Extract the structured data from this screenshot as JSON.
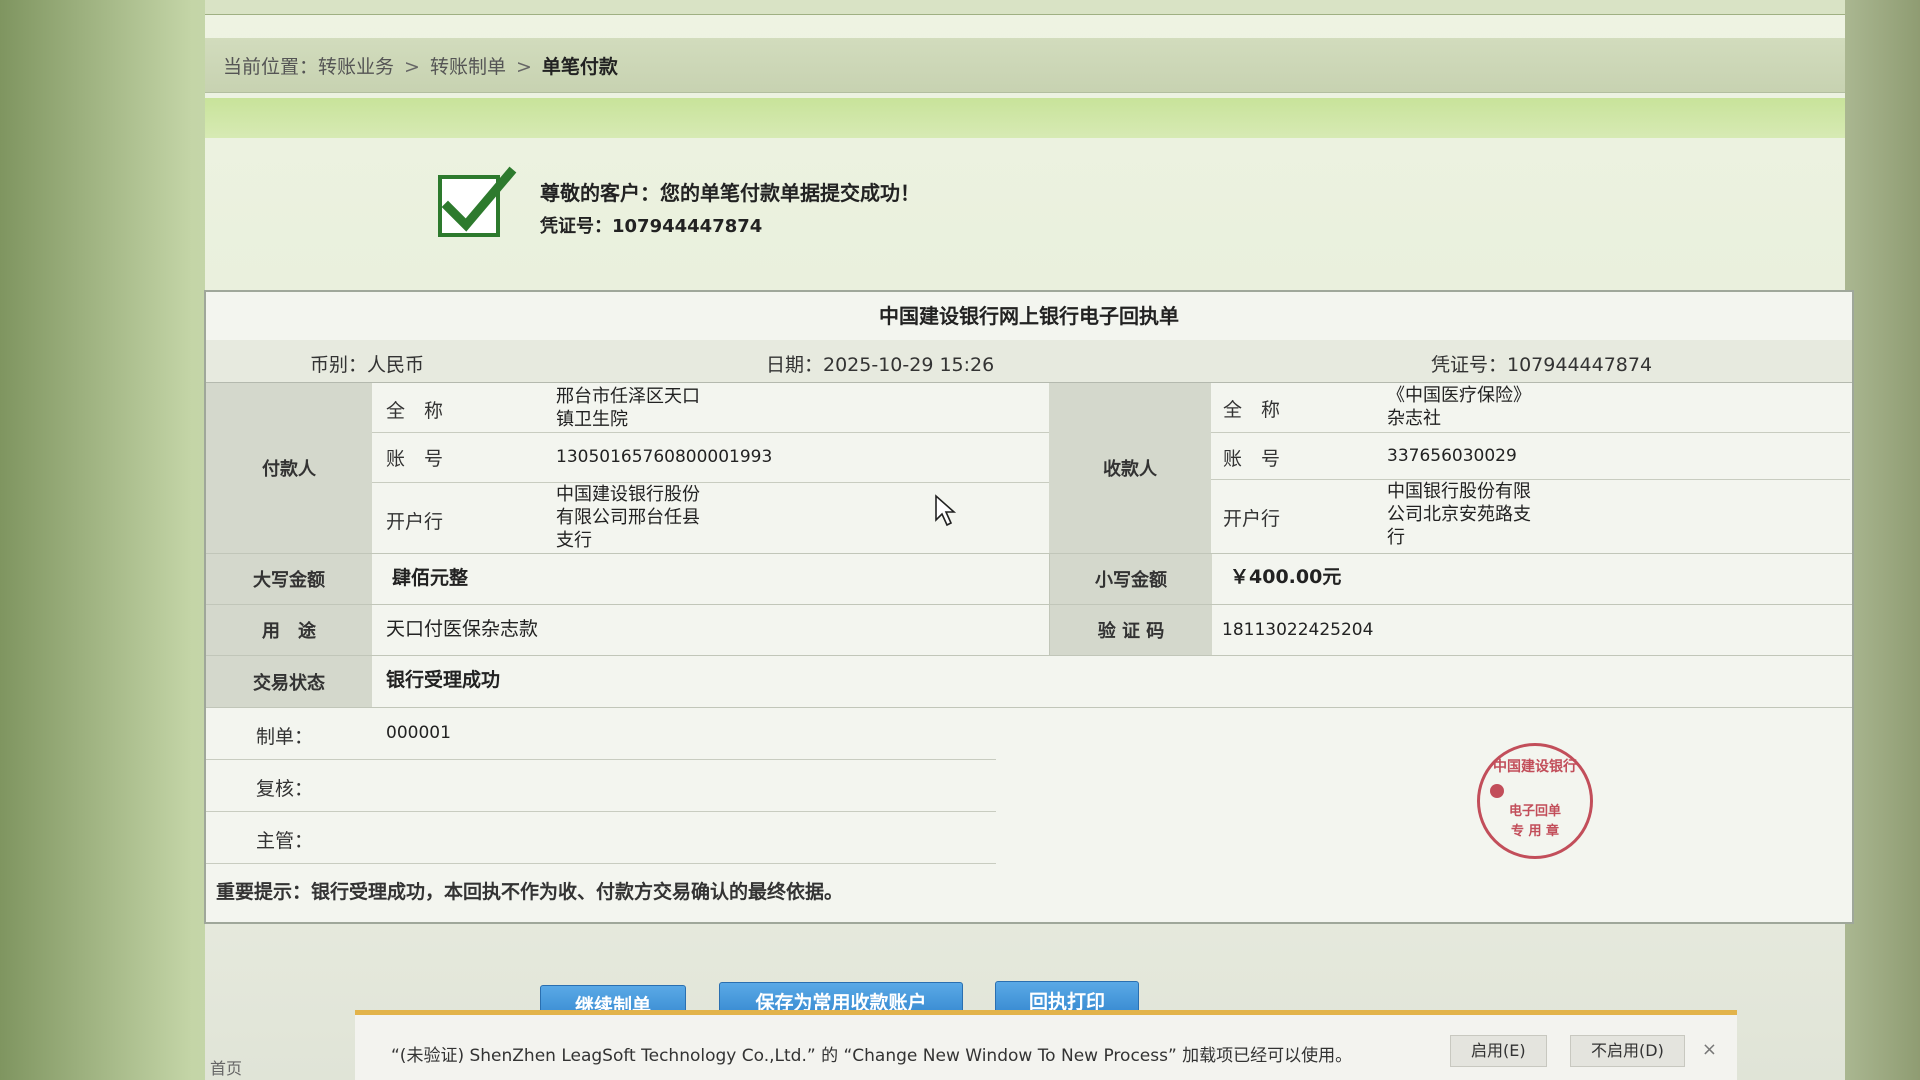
{
  "breadcrumb": {
    "prefix": "当前位置：",
    "items": [
      "转账业务",
      "转账制单",
      "单笔付款"
    ],
    "sep": ">"
  },
  "success": {
    "message": "尊敬的客户：您的单笔付款单据提交成功！",
    "voucher_line": "凭证号：107944447874"
  },
  "receipt": {
    "title": "中国建设银行网上银行电子回执单",
    "currency": "币别：人民币",
    "date": "日期：2025-10-29 15:26",
    "voucher": "凭证号：107944447874",
    "payer_label": "付款人",
    "payee_label": "收款人",
    "payer": {
      "name_label": "全　称",
      "name": [
        "邢台市任泽区天口",
        "镇卫生院"
      ],
      "account_label": "账　号",
      "account": "13050165760800001993",
      "bank_label": "开户行",
      "bank": [
        "中国建设银行股份",
        "有限公司邢台任县",
        "支行"
      ]
    },
    "payee": {
      "name_label": "全　称",
      "name": [
        "《中国医疗保险》",
        "杂志社"
      ],
      "account_label": "账　号",
      "account": "337656030029",
      "bank_label": "开户行",
      "bank": [
        "中国银行股份有限",
        "公司北京安苑路支",
        "行"
      ]
    },
    "amount_words_label": "大写金额",
    "amount_words": "肆佰元整",
    "amount_label": "小写金额",
    "amount": "￥400.00元",
    "purpose_label": "用　途",
    "purpose": "天口付医保杂志款",
    "verify_label": "验 证 码",
    "verify_code": "18113022425204",
    "status_label": "交易状态",
    "status": "银行受理成功",
    "maker_label": "制单：",
    "maker": "000001",
    "checker_label": "复核：",
    "checker": "",
    "supervisor_label": "主管：",
    "supervisor": "",
    "notice": "重要提示：银行受理成功，本回执不作为收、付款方交易确认的最终依据。",
    "stamp": {
      "arc": "中国建设银行",
      "line1": "电子回单",
      "line2": "专 用 章"
    }
  },
  "buttons": {
    "continue": "继续制单",
    "save_payee": "保存为常用收款账户",
    "print": "回执打印"
  },
  "infobar": {
    "text": "“(未验证) ShenZhen LeagSoft Technology Co.,Ltd.” 的 “Change New Window To New Process” 加载项已经可以使用。",
    "enable": "启用(E)",
    "disable": "不启用(D)",
    "close": "×"
  },
  "bottom_left": "首页",
  "icons": {
    "check": "check-icon",
    "cursor": "mouse-cursor-icon",
    "close": "close-icon"
  },
  "colors": {
    "accent_green": "#2d7a2d",
    "button_blue": "#2f82cc",
    "stamp_red": "#c24e5a",
    "infobar_border": "#e2b34a"
  }
}
